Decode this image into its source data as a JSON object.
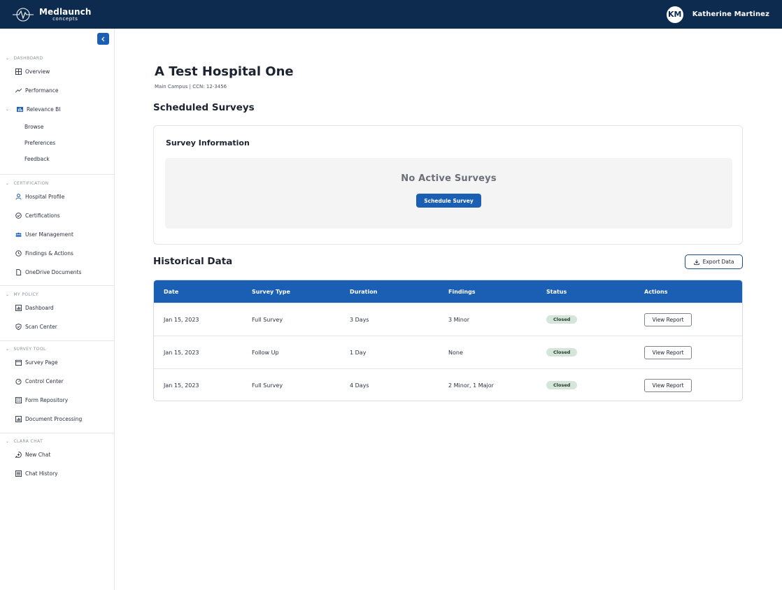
{
  "header": {
    "brand_name": "Medlaunch",
    "brand_sub": "concepts",
    "user_initials": "KM",
    "user_name": "Katherine Martinez"
  },
  "sidebar": {
    "sections": [
      {
        "label": "DASHBOARD"
      },
      {
        "label": "CERTIFICATION"
      },
      {
        "label": "MY POLICY"
      },
      {
        "label": "SURVEY TOOL"
      },
      {
        "label": "CLARA CHAT"
      }
    ],
    "dashboard": {
      "overview": "Overview",
      "performance": "Performance",
      "relevance_bi": "Relevance BI",
      "browse": "Browse",
      "preferences": "Preferences",
      "feedback": "Feedback"
    },
    "certification": {
      "hospital_profile": "Hospital Profile",
      "certifications": "Certifications",
      "user_management": "User Management",
      "findings_actions": "Findings & Actions",
      "onedrive_documents": "OneDrive Documents"
    },
    "my_policy": {
      "dashboard": "Dashboard",
      "scan_center": "Scan Center"
    },
    "survey_tool": {
      "survey_page": "Survey Page",
      "control_center": "Control Center",
      "form_repository": "Form Repository",
      "document_processing": "Document Processing"
    },
    "clara_chat": {
      "new_chat": "New Chat",
      "chat_history": "Chat History"
    }
  },
  "main": {
    "title": "A Test Hospital One",
    "subtitle": "Main Campus | CCN: 12-3456",
    "scheduled_title": "Scheduled Surveys",
    "survey_info_title": "Survey Information",
    "empty_text": "No Active Surveys",
    "schedule_button": "Schedule Survey",
    "historical_title": "Historical Data",
    "export_button": "Export Data",
    "table": {
      "headers": [
        "Date",
        "Survey Type",
        "Duration",
        "Findings",
        "Status",
        "Actions"
      ],
      "rows": [
        {
          "date": "Jan 15, 2023",
          "type": "Full Survey",
          "duration": "3 Days",
          "findings": "3 Minor",
          "status": "Closed",
          "action": "View Report"
        },
        {
          "date": "Jan 15, 2023",
          "type": "Follow Up",
          "duration": "1 Day",
          "findings": "None",
          "status": "Closed",
          "action": "View Report"
        },
        {
          "date": "Jan 15, 2023",
          "type": "Full Survey",
          "duration": "4 Days",
          "findings": "2 Minor, 1 Major",
          "status": "Closed",
          "action": "View Report"
        }
      ]
    }
  },
  "colors": {
    "topbar": "#0d2a4f",
    "primary": "#1a5fb4",
    "badge_bg": "#d5e5d9"
  }
}
